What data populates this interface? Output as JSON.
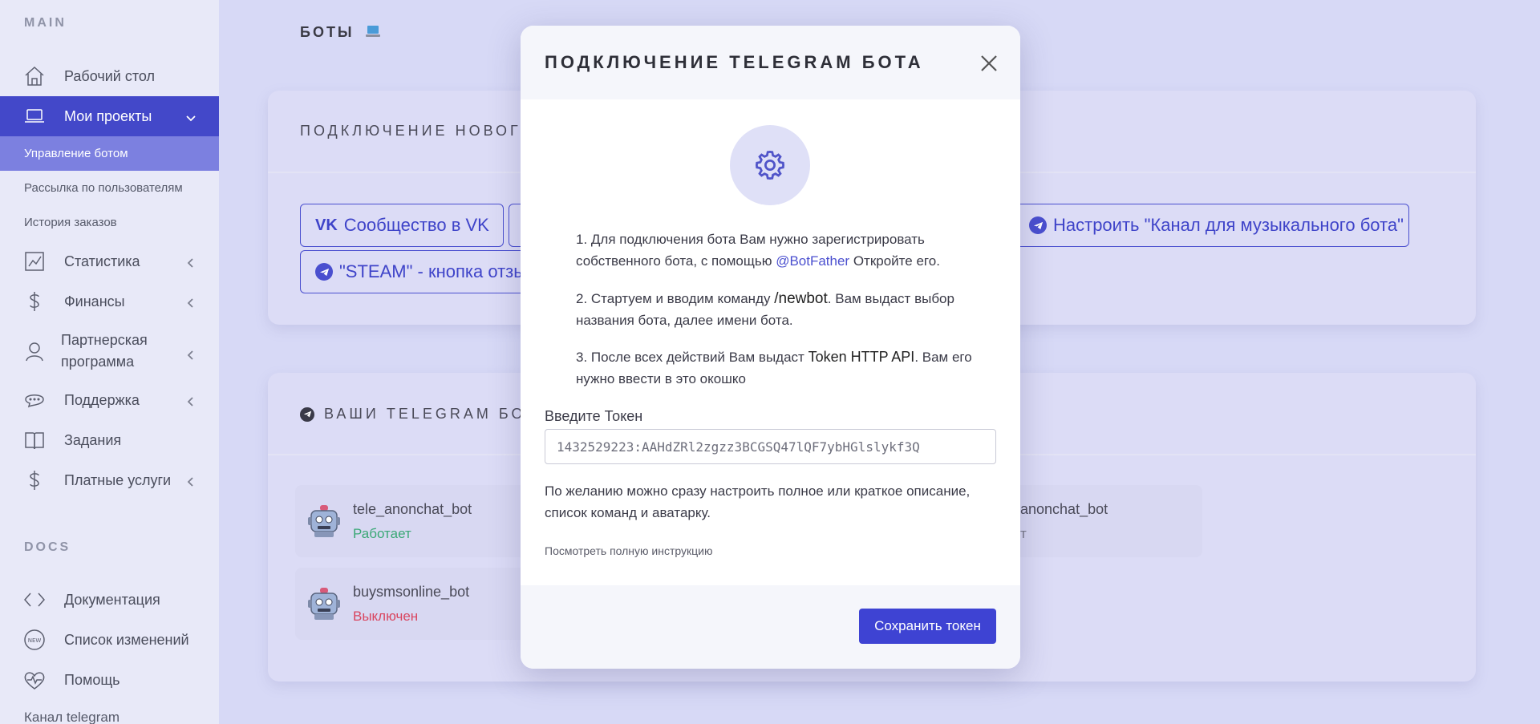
{
  "sidebar": {
    "section_main": "MAIN",
    "section_docs": "DOCS",
    "items": [
      {
        "label": "Рабочий стол",
        "icon": "home-icon"
      },
      {
        "label": "Мои проекты",
        "icon": "laptop-icon",
        "active": true
      },
      {
        "label": "Статистика",
        "icon": "chart-icon"
      },
      {
        "label": "Финансы",
        "icon": "dollar-icon"
      },
      {
        "label": "Партнерская программа",
        "icon": "user-icon"
      },
      {
        "label": "Поддержка",
        "icon": "chat-icon"
      },
      {
        "label": "Задания",
        "icon": "book-icon"
      },
      {
        "label": "Платные услуги",
        "icon": "dollar-icon"
      }
    ],
    "subitems": [
      {
        "label": "Управление ботом",
        "active": true
      },
      {
        "label": "Рассылка по пользователям"
      },
      {
        "label": "История заказов"
      }
    ],
    "docs_items": [
      {
        "label": "Документация",
        "icon": "code-icon"
      },
      {
        "label": "Список изменений",
        "icon": "new-badge-icon"
      },
      {
        "label": "Помощь",
        "icon": "heart-pulse-icon"
      },
      {
        "label": "Канал telegram"
      }
    ]
  },
  "main": {
    "page_title": "БОТЫ",
    "connect_card_title": "ПОДКЛЮЧЕНИЕ НОВОГО",
    "buttons": [
      {
        "label": "Сообщество в VK"
      },
      {
        "label": "Настроить \"Канал для музыкального бота\""
      },
      {
        "label": "\"STEAM\" - кнопка отзы"
      }
    ],
    "bots_card_title": "ВАШИ TELEGRAM БОТ",
    "bots": [
      {
        "name": "tele_anonchat_bot",
        "status": "Работает",
        "status_color": "#3aa876"
      },
      {
        "name": "buysmsonline_bot",
        "status": "Выключен",
        "status_color": "#d9455f"
      },
      {
        "name": "anonchat_bot",
        "status": "т"
      }
    ]
  },
  "modal": {
    "title": "ПОДКЛЮЧЕНИЕ TELEGRAM БОТА",
    "step1_text": "1. Для подключения бота Вам нужно зарегистрировать собственного бота, с помощью",
    "step1_link": "@BotFather",
    "step1_tail": "Откройте его.",
    "step2_pre": "2. Стартуем и вводим команду",
    "step2_cmd": "/newbot",
    "step2_tail": ". Вам выдаст выбор названия бота, далее имени бота.",
    "step3_pre": "3. После всех действий Вам выдаст",
    "step3_cmd": "Token HTTP API",
    "step3_tail": ". Вам его нужно ввести в это окошко",
    "token_label": "Введите Токен",
    "token_value": "1432529223:AAHdZRl2zgzz3BCGSQ47lQF7ybHGlslykf3Q",
    "note": "По желанию можно сразу настроить полное или краткое описание, список команд и аватарку.",
    "instruction_link": "Посмотреть полную инструкцию",
    "save_label": "Сохранить токен"
  },
  "colors": {
    "accent": "#4348c9",
    "button": "#3e43d3"
  }
}
